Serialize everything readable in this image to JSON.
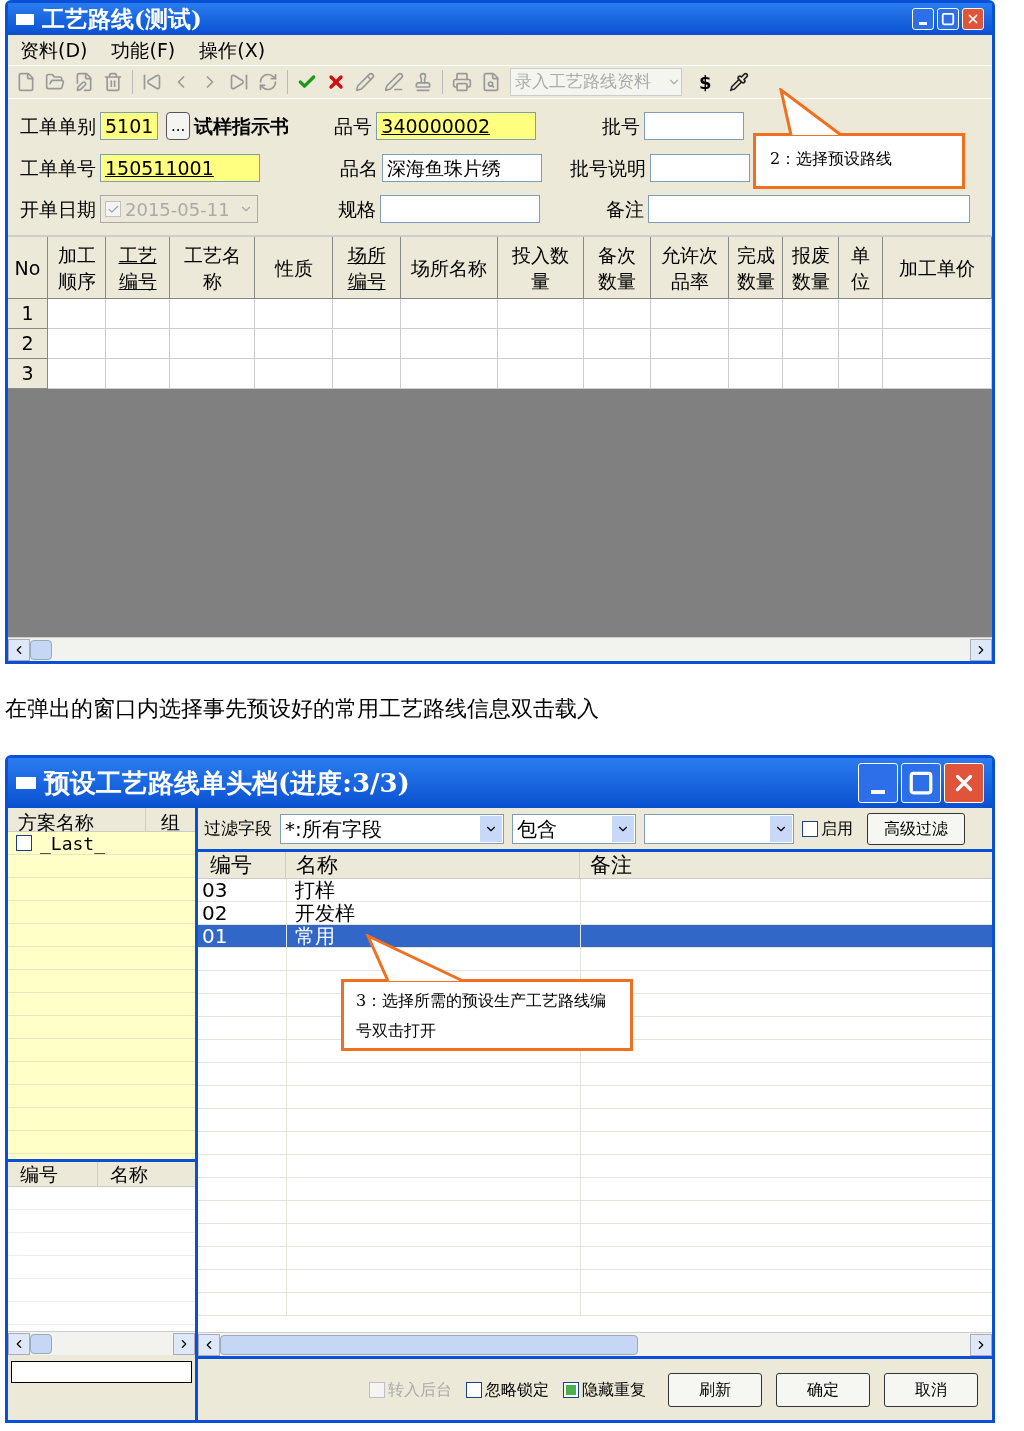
{
  "route_window": {
    "title": "工艺路线(测试)",
    "menu": [
      "资料(D)",
      "功能(F)",
      "操作(X)"
    ],
    "toolbar": {
      "dropdown": {
        "value": "录入工艺路线资料",
        "disabled": true
      },
      "currency": "$"
    },
    "form": {
      "order_type": {
        "label": "工单单别",
        "value": "5101",
        "highlighted": true,
        "underlined": false,
        "ellipsis": "...",
        "note": "试样指示书"
      },
      "order_no": {
        "label": "工单单号",
        "value": "150511001",
        "highlighted": true,
        "underlined": true
      },
      "open_date": {
        "label": "开单日期",
        "value": "2015-05-11",
        "checked": true,
        "disabled": true
      },
      "item_no": {
        "label": "品号",
        "value": "340000002",
        "highlighted": true,
        "underlined": true
      },
      "item_name": {
        "label": "品名",
        "value": "深海鱼珠片绣",
        "highlighted": false,
        "underlined": false
      },
      "spec": {
        "label": "规格"
      },
      "batch": {
        "label": "批号"
      },
      "batch_desc": {
        "label": "批号说明"
      },
      "remark": {
        "label": "备注"
      }
    },
    "grid": {
      "columns": [
        {
          "lines": [
            "No"
          ],
          "underlined": false
        },
        {
          "lines": [
            "加工",
            "顺序"
          ],
          "underlined": false
        },
        {
          "lines": [
            "工艺",
            "编号"
          ],
          "underlined": true
        },
        {
          "lines": [
            "工艺名",
            "称"
          ],
          "underlined": false
        },
        {
          "lines": [
            "性质"
          ],
          "underlined": false
        },
        {
          "lines": [
            "场所",
            "编号"
          ],
          "underlined": true
        },
        {
          "lines": [
            "场所名称"
          ],
          "underlined": false
        },
        {
          "lines": [
            "投入数",
            "量"
          ],
          "underlined": false
        },
        {
          "lines": [
            "备次",
            "数量"
          ],
          "underlined": false
        },
        {
          "lines": [
            "允许次",
            "品率"
          ],
          "underlined": false
        },
        {
          "lines": [
            "完成",
            "数量"
          ],
          "underlined": false
        },
        {
          "lines": [
            "报废",
            "数量"
          ],
          "underlined": false
        },
        {
          "lines": [
            "单",
            "位"
          ],
          "underlined": false
        },
        {
          "lines": [
            "加工单价"
          ],
          "underlined": false
        }
      ],
      "rows": [
        "1",
        "2",
        "3"
      ]
    }
  },
  "callout_1": "2：选择预设路线",
  "caption": "在弹出的窗口内选择事先预设好的常用工艺路线信息双击载入",
  "preset_window": {
    "title": "预设工艺路线单头档(进度:3/3)",
    "plans": {
      "columns": [
        "方案名称",
        "组"
      ],
      "rows": [
        {
          "name": "_Last_",
          "checked": false
        }
      ]
    },
    "detail": {
      "columns": [
        "编号",
        "名称"
      ]
    },
    "filter": {
      "label": "过滤字段",
      "field": "*:所有字段",
      "operator": "包含",
      "enabled": {
        "label": "启用",
        "checked": false
      },
      "advanced": "高级过滤"
    },
    "list": {
      "columns": [
        "编号",
        "名称",
        "备注"
      ],
      "rows": [
        {
          "code": "03",
          "name": "打样",
          "selected": false
        },
        {
          "code": "02",
          "name": "开发样",
          "selected": false
        },
        {
          "code": "01",
          "name": "常用",
          "selected": true
        }
      ]
    },
    "options": [
      {
        "label": "转入后台",
        "checked": false,
        "disabled": true
      },
      {
        "label": "忽略锁定",
        "checked": false,
        "disabled": false
      },
      {
        "label": "隐藏重复",
        "checked": true,
        "disabled": false
      }
    ],
    "buttons": [
      "刷新",
      "确定",
      "取消"
    ]
  },
  "callout_2": "3：选择所需的预设生产工艺路线编号双击打开"
}
